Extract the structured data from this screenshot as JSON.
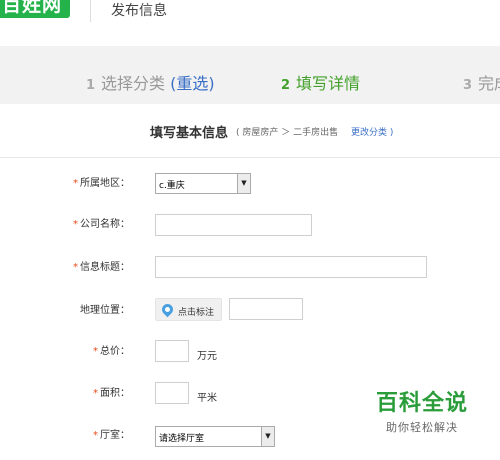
{
  "header": {
    "logo_text": "百姓网",
    "title": "发布信息"
  },
  "steps": [
    {
      "num": "1",
      "label": "选择分类",
      "link": "(重选)"
    },
    {
      "num": "2",
      "label": "填写详情"
    },
    {
      "num": "3",
      "label": "完成"
    }
  ],
  "section": {
    "title": "填写基本信息",
    "breadcrumb": "( 房屋房产 ＞ 二手房出售",
    "change_link": "更改分类 )"
  },
  "form": {
    "required_mark": "*",
    "region": {
      "label": "所属地区：",
      "value": "c.重庆"
    },
    "company": {
      "label": "公司名称：",
      "value": ""
    },
    "title": {
      "label": "信息标题：",
      "value": ""
    },
    "location": {
      "label": "地理位置：",
      "button_label": "点击标注",
      "value": ""
    },
    "price": {
      "label": "总价：",
      "value": "",
      "unit": "万元"
    },
    "area": {
      "label": "面积：",
      "value": "",
      "unit": "平米"
    },
    "rooms": {
      "label": "厅室：",
      "value": "请选择厅室"
    }
  },
  "watermark": {
    "main": "百科全说",
    "sub": "助你轻松解决"
  }
}
